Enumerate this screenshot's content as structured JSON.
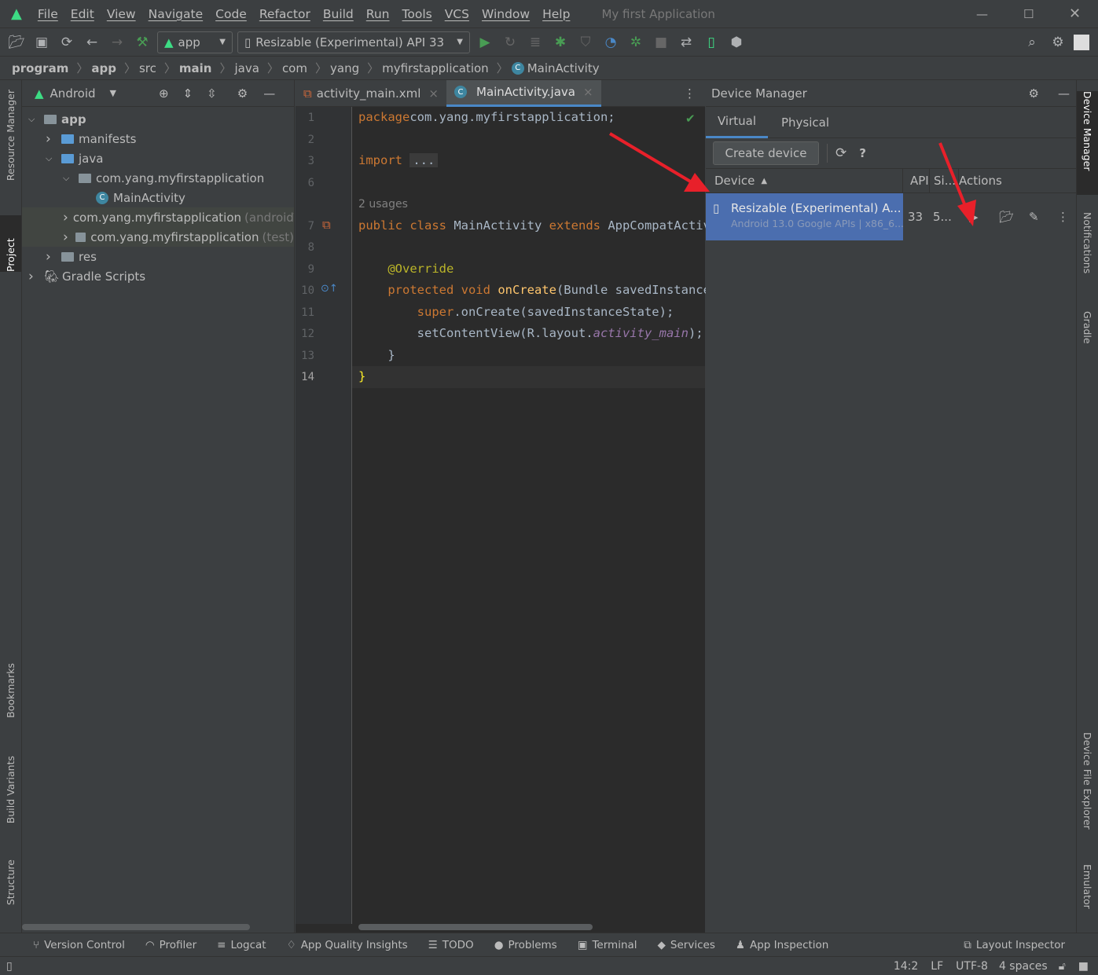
{
  "titlebar": {
    "menu": [
      "File",
      "Edit",
      "View",
      "Navigate",
      "Code",
      "Refactor",
      "Build",
      "Run",
      "Tools",
      "VCS",
      "Window",
      "Help"
    ],
    "project_title": "My first Application"
  },
  "toolbar": {
    "module": "app",
    "device": "Resizable (Experimental) API 33"
  },
  "breadcrumb": [
    "program",
    "app",
    "src",
    "main",
    "java",
    "com",
    "yang",
    "myfirstapplication",
    "MainActivity"
  ],
  "left_stripe": [
    "Resource Manager",
    "Project",
    "Bookmarks",
    "Build Variants",
    "Structure"
  ],
  "right_stripe": [
    "Device Manager",
    "Notifications",
    "Gradle",
    "Device File Explorer",
    "Emulator"
  ],
  "project": {
    "view": "Android",
    "tree": [
      {
        "label": "app",
        "depth": 0,
        "open": true,
        "icon": "module",
        "bold": true
      },
      {
        "label": "manifests",
        "depth": 1,
        "open": false,
        "icon": "folder-blue"
      },
      {
        "label": "java",
        "depth": 1,
        "open": true,
        "icon": "folder-blue"
      },
      {
        "label": "com.yang.myfirstapplication",
        "depth": 2,
        "open": true,
        "icon": "package"
      },
      {
        "label": "MainActivity",
        "depth": 3,
        "icon": "class"
      },
      {
        "label": "com.yang.myfirstapplication",
        "suffix": "(androidTest)",
        "depth": 2,
        "open": false,
        "icon": "package",
        "highlight": true
      },
      {
        "label": "com.yang.myfirstapplication",
        "suffix": "(test)",
        "depth": 2,
        "open": false,
        "icon": "package",
        "highlight": true
      },
      {
        "label": "res",
        "depth": 1,
        "open": false,
        "icon": "folder"
      },
      {
        "label": "Gradle Scripts",
        "depth": 0,
        "open": false,
        "icon": "gradle"
      }
    ]
  },
  "editor": {
    "tabs": [
      {
        "label": "activity_main.xml",
        "active": false
      },
      {
        "label": "MainActivity.java",
        "active": true
      }
    ],
    "lines": [
      {
        "n": "1",
        "t": [
          [
            "kw",
            "package"
          ],
          [
            "",
            "com.yang.myfirstapplication;"
          ]
        ]
      },
      {
        "n": "2",
        "t": []
      },
      {
        "n": "3",
        "t": [
          [
            "kw",
            "import"
          ],
          [
            "",
            " "
          ],
          [
            "fold",
            "..."
          ]
        ]
      },
      {
        "n": "6",
        "t": []
      },
      {
        "n": "",
        "t": [
          [
            "hint",
            "2 usages"
          ]
        ]
      },
      {
        "n": "7",
        "t": [
          [
            "kw",
            "public class "
          ],
          [
            "",
            "MainActivity "
          ],
          [
            "kw",
            "extends "
          ],
          [
            "",
            "AppCompatActivity {"
          ]
        ]
      },
      {
        "n": "8",
        "t": []
      },
      {
        "n": "9",
        "t": [
          [
            "",
            "    "
          ],
          [
            "ann",
            "@Override"
          ]
        ]
      },
      {
        "n": "10",
        "t": [
          [
            "",
            "    "
          ],
          [
            "kw",
            "protected void "
          ],
          [
            "fn",
            "onCreate"
          ],
          [
            "",
            "(Bundle savedInstanceState) {"
          ]
        ]
      },
      {
        "n": "11",
        "t": [
          [
            "",
            "        "
          ],
          [
            "kw",
            "super"
          ],
          [
            "",
            ".onCreate(savedInstanceState);"
          ]
        ]
      },
      {
        "n": "12",
        "t": [
          [
            "",
            "        setContentView(R.layout."
          ],
          [
            "it",
            "activity_main"
          ],
          [
            "",
            ");"
          ]
        ]
      },
      {
        "n": "13",
        "t": [
          [
            "",
            "    }"
          ]
        ]
      },
      {
        "n": "14",
        "t": [
          [
            "brace",
            "}"
          ]
        ]
      }
    ]
  },
  "device_manager": {
    "title": "Device Manager",
    "tabs": [
      "Virtual",
      "Physical"
    ],
    "active_tab": "Virtual",
    "create_label": "Create device",
    "help": "?",
    "columns": [
      "Device",
      "API",
      "Si...",
      "Actions"
    ],
    "devices": [
      {
        "name": "Resizable (Experimental) A...",
        "detail": "Android 13.0 Google APIs | x86_6...",
        "api": "33",
        "size": "5..."
      }
    ]
  },
  "bottom_tools": [
    "Version Control",
    "Profiler",
    "Logcat",
    "App Quality Insights",
    "TODO",
    "Problems",
    "Terminal",
    "Services",
    "App Inspection"
  ],
  "bottom_right_tool": "Layout Inspector",
  "status": {
    "position": "14:2",
    "line_sep": "LF",
    "encoding": "UTF-8",
    "indent": "4 spaces"
  },
  "colors": {
    "accent": "#4a88c7",
    "selection": "#4b6eaf",
    "android_green": "#3ddc84",
    "arrow": "#e8202a",
    "keyword": "#cc7832"
  }
}
